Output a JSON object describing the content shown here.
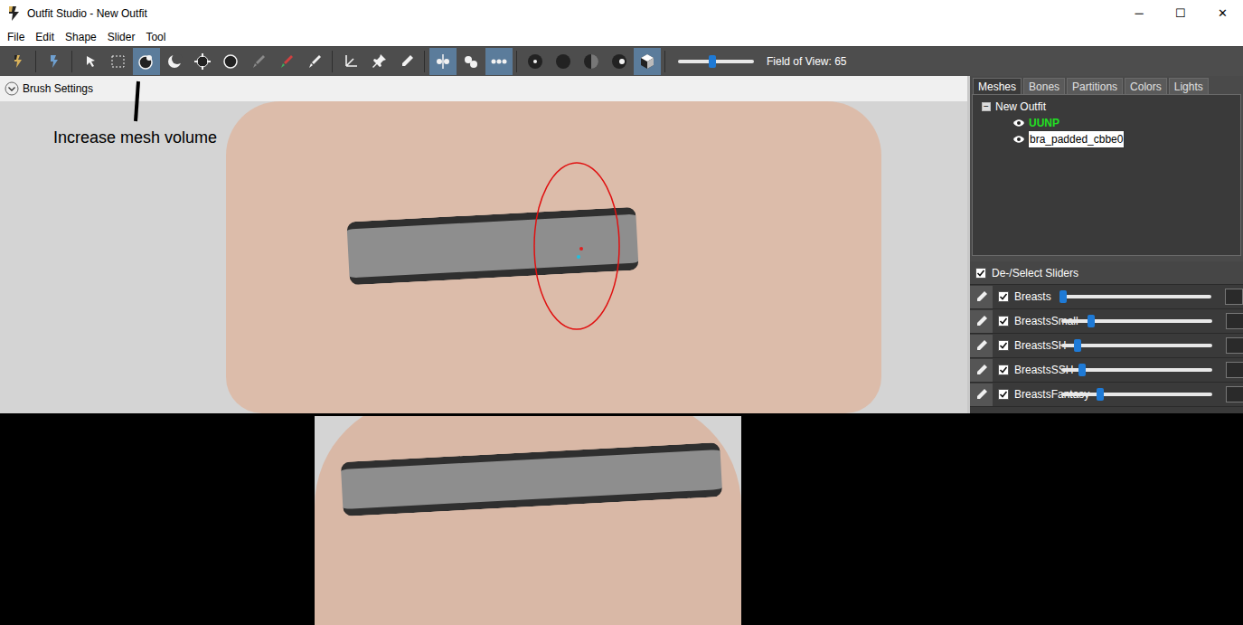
{
  "window": {
    "title": "Outfit Studio - New Outfit",
    "controls": [
      "─",
      "☐",
      "✕"
    ]
  },
  "menu": [
    "File",
    "Edit",
    "Shape",
    "Slider",
    "Tool"
  ],
  "toolbar": {
    "groups": [
      [
        {
          "kind": "logo",
          "selected": false,
          "disabled": false
        }
      ],
      [
        {
          "kind": "logo2",
          "selected": false,
          "disabled": false
        }
      ],
      [
        {
          "kind": "arrow",
          "selected": false,
          "disabled": false
        },
        {
          "kind": "select",
          "selected": false,
          "disabled": false
        },
        {
          "kind": "sphere",
          "selected": true,
          "disabled": false
        },
        {
          "kind": "moon",
          "selected": false,
          "disabled": false
        },
        {
          "kind": "move",
          "selected": false,
          "disabled": false
        },
        {
          "kind": "smooth",
          "selected": false,
          "disabled": false
        },
        {
          "kind": "brush",
          "selected": false,
          "disabled": true
        },
        {
          "kind": "colorbrush",
          "selected": false,
          "disabled": false
        },
        {
          "kind": "brush",
          "selected": false,
          "disabled": false
        }
      ],
      [
        {
          "kind": "transform",
          "selected": false,
          "disabled": false
        },
        {
          "kind": "pin",
          "selected": false,
          "disabled": false
        },
        {
          "kind": "pen",
          "selected": false,
          "disabled": false
        }
      ],
      [
        {
          "kind": "mirror",
          "selected": true,
          "disabled": false
        },
        {
          "kind": "twodots",
          "selected": false,
          "disabled": false
        },
        {
          "kind": "threedots",
          "selected": true,
          "disabled": false
        }
      ],
      [
        {
          "kind": "dotsmall",
          "selected": false,
          "disabled": false
        },
        {
          "kind": "dotlarge",
          "selected": false,
          "disabled": false
        },
        {
          "kind": "halfdot",
          "selected": false,
          "disabled": false
        },
        {
          "kind": "halfdot2",
          "selected": false,
          "disabled": false
        },
        {
          "kind": "cube",
          "selected": true,
          "disabled": false
        }
      ]
    ],
    "fov": {
      "label": "Field of View: 65",
      "level": 0.45
    }
  },
  "brush_settings": {
    "label": "Brush Settings"
  },
  "annotation": {
    "text": "Increase mesh volume"
  },
  "tabs": [
    {
      "label": "Meshes",
      "selected": true
    },
    {
      "label": "Bones",
      "selected": false
    },
    {
      "label": "Partitions",
      "selected": false
    },
    {
      "label": "Colors",
      "selected": false
    },
    {
      "label": "Lights",
      "selected": false
    }
  ],
  "tree": {
    "root": {
      "label": "New Outfit",
      "toggle": "−",
      "expanded": true
    },
    "items": [
      {
        "label": "UUNP",
        "visible": true,
        "selected": false,
        "reference": true,
        "color": "#22e022"
      },
      {
        "label": "bra_padded_cbbe0",
        "visible": true,
        "selected": true,
        "reference": false,
        "color": "#000000"
      }
    ]
  },
  "sliders": {
    "header": "De-/Select Sliders",
    "header_checked": true,
    "rows": [
      {
        "name": "Breasts",
        "checked": true,
        "level": 0.02
      },
      {
        "name": "BreastsSmall",
        "checked": true,
        "level": 0.2
      },
      {
        "name": "BreastsSH",
        "checked": true,
        "level": 0.11
      },
      {
        "name": "BreastsSSH",
        "checked": true,
        "level": 0.14
      },
      {
        "name": "BreastsFantasy",
        "checked": true,
        "level": 0.26
      }
    ]
  }
}
